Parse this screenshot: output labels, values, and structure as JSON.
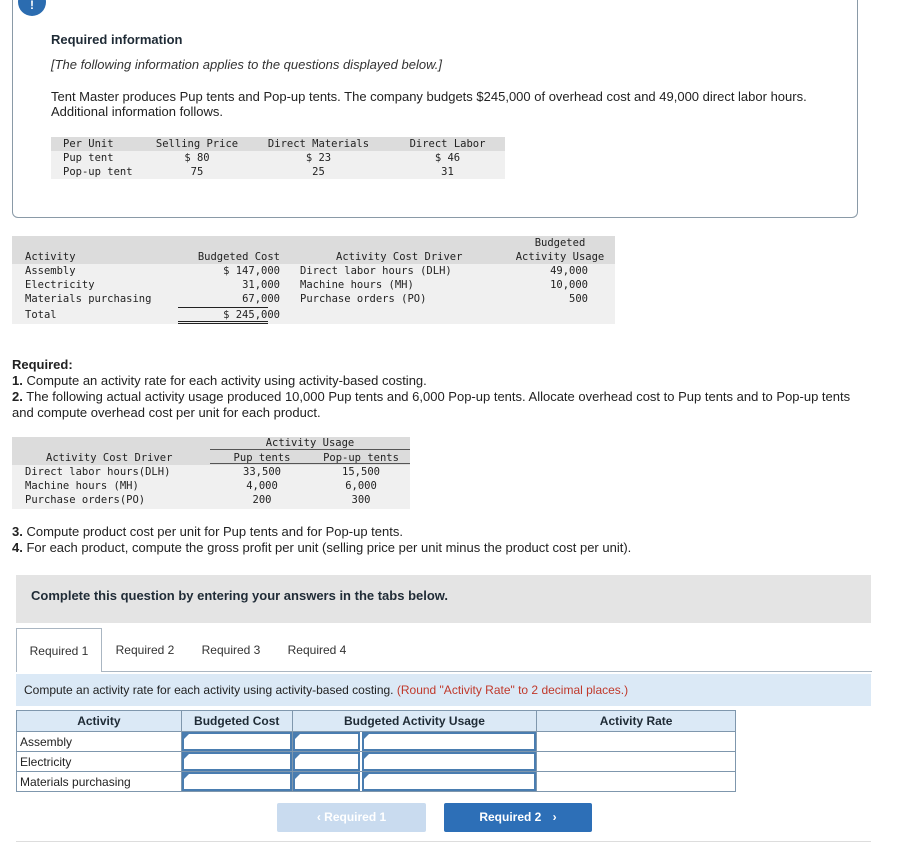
{
  "header": {
    "alert_icon": "!",
    "title": "Required information",
    "note": "[The following information applies to the questions displayed below.]",
    "intro": "Tent Master produces Pup tents and Pop-up tents. The company budgets $245,000 of overhead cost and 49,000 direct labor hours. Additional information follows."
  },
  "product_table": {
    "headers": [
      "Per Unit",
      "Selling Price",
      "Direct Materials",
      "Direct Labor"
    ],
    "rows": [
      [
        "Pup tent",
        "$ 80",
        "$ 23",
        "$ 46"
      ],
      [
        "Pop-up tent",
        "75",
        "25",
        "31"
      ]
    ]
  },
  "activity_table": {
    "headers": {
      "activity": "Activity",
      "budgeted_cost": "Budgeted Cost",
      "driver": "Activity Cost Driver",
      "usage_line1": "Budgeted",
      "usage_line2": "Activity Usage"
    },
    "rows": [
      {
        "activity": "Assembly",
        "cost": "$ 147,000",
        "driver": "Direct labor hours (DLH)",
        "usage": "49,000"
      },
      {
        "activity": "Electricity",
        "cost": "31,000",
        "driver": "Machine hours (MH)",
        "usage": "10,000"
      },
      {
        "activity": "Materials purchasing",
        "cost": "67,000",
        "driver": "Purchase orders (PO)",
        "usage": "500"
      }
    ],
    "total": {
      "label": "Total",
      "cost": "$ 245,000"
    }
  },
  "required": {
    "title": "Required:",
    "q1_num": "1.",
    "q1": "Compute an activity rate for each activity using activity-based costing.",
    "q2_num": "2.",
    "q2": "The following actual activity usage produced 10,000 Pup tents and 6,000 Pop-up tents. Allocate overhead cost to Pup tents and to Pop-up tents and compute overhead cost per unit for each product."
  },
  "usage_table": {
    "group_header": "Activity Usage",
    "headers": [
      "Activity Cost Driver",
      "Pup tents",
      "Pop-up tents"
    ],
    "rows": [
      [
        "Direct labor hours(DLH)",
        "33,500",
        "15,500"
      ],
      [
        "Machine hours (MH)",
        "4,000",
        "6,000"
      ],
      [
        "Purchase orders(PO)",
        "200",
        "300"
      ]
    ]
  },
  "questions_more": {
    "q3_num": "3.",
    "q3": "Compute product cost per unit for Pup tents and for Pop-up tents.",
    "q4_num": "4.",
    "q4": "For each product, compute the gross profit per unit (selling price per unit minus the product cost per unit)."
  },
  "banner": "Complete this question by entering your answers in the tabs below.",
  "tabs": [
    {
      "label": "Required 1"
    },
    {
      "label": "Required 2"
    },
    {
      "label": "Required 3"
    },
    {
      "label": "Required 4"
    }
  ],
  "question": {
    "text": "Compute an activity rate for each activity using activity-based costing.",
    "note": "(Round \"Activity Rate\" to 2 decimal places.)"
  },
  "answer_table": {
    "headers": [
      "Activity",
      "Budgeted Cost",
      "Budgeted Activity Usage",
      "Activity Rate"
    ],
    "rows": [
      {
        "activity": "Assembly",
        "budgeted_cost": "",
        "usage": "",
        "rate": ""
      },
      {
        "activity": "Electricity",
        "budgeted_cost": "",
        "usage": "",
        "rate": ""
      },
      {
        "activity": "Materials purchasing",
        "budgeted_cost": "",
        "usage": "",
        "rate": ""
      }
    ]
  },
  "nav": {
    "prev_label": "Required 1",
    "next_label": "Required 2",
    "prev_icon": "‹",
    "next_icon": "›"
  },
  "colors": {
    "accent": "#2d6fb7",
    "note_red": "#c0392b",
    "light_blue": "#dbe9f6"
  }
}
